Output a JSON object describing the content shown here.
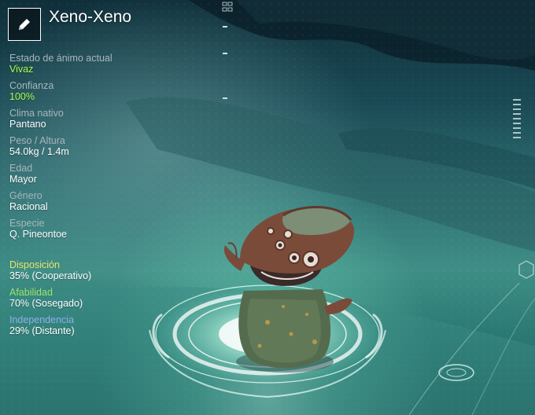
{
  "creature": {
    "name": "Xeno-Xeno"
  },
  "icons": {
    "edit": "pencil-icon"
  },
  "stats": [
    {
      "label": "Estado de ánimo actual",
      "value": "Vivaz",
      "value_color": "#a6ff4d"
    },
    {
      "label": "Confianza",
      "value": "100%",
      "value_color": "#a6ff4d"
    },
    {
      "label": "Clima nativo",
      "value": "Pantano",
      "value_color": "#ffffff"
    },
    {
      "label": "Peso / Altura",
      "value": "54.0kg / 1.4m",
      "value_color": "#ffffff"
    },
    {
      "label": "Edad",
      "value": "Mayor",
      "value_color": "#ffffff"
    },
    {
      "label": "Género",
      "value": "Racional",
      "value_color": "#ffffff"
    },
    {
      "label": "Especie",
      "value": "Q. Pineontoe",
      "value_color": "#ffffff"
    }
  ],
  "traits": [
    {
      "label": "Disposición",
      "value": "35% (Cooperativo)",
      "label_color": "#e8e56a"
    },
    {
      "label": "Afabilidad",
      "value": "70% (Sosegado)",
      "label_color": "#9be36a"
    },
    {
      "label": "Independencia",
      "value": "29% (Distante)",
      "label_color": "#8fb0e8"
    }
  ],
  "colors": {
    "accent_green": "#a6ff4d",
    "label_gray": "#a7b7bb"
  }
}
